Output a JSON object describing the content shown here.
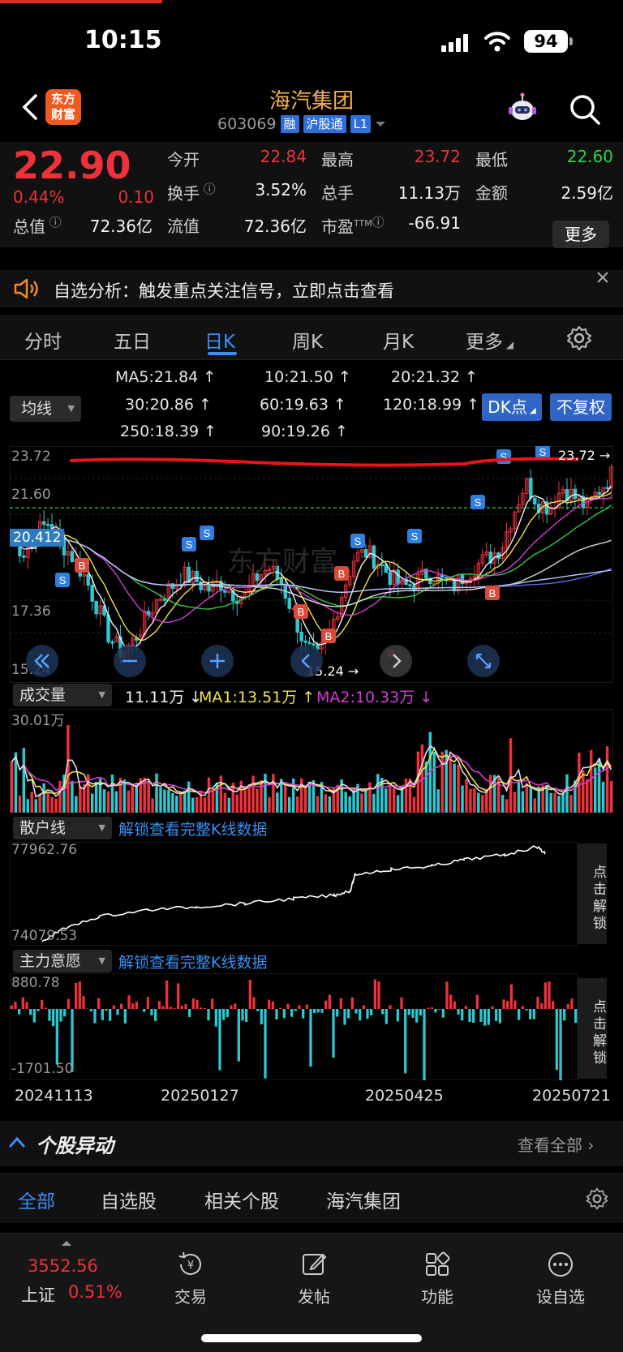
{
  "status_bar": {
    "time": "10:15",
    "battery": "94"
  },
  "header": {
    "stock_name": "海汽集团",
    "code": "603069",
    "tags": [
      "融",
      "沪股通",
      "L1"
    ],
    "logo_text": "东方财富"
  },
  "quote": {
    "price": "22.90",
    "change_pct": "0.44%",
    "change": "0.10",
    "rows": [
      [
        {
          "label": "今开",
          "value": "22.84",
          "color": "red"
        },
        {
          "label": "最高",
          "value": "23.72",
          "color": "red"
        },
        {
          "label": "最低",
          "value": "22.60",
          "color": "green"
        }
      ],
      [
        {
          "label": "换手",
          "value": "3.52%",
          "color": "white"
        },
        {
          "label": "总手",
          "value": "11.13万",
          "color": "white"
        },
        {
          "label": "金额",
          "value": "2.59亿",
          "color": "white"
        }
      ],
      [
        {
          "label": "总值",
          "value": "72.36亿",
          "color": "white"
        },
        {
          "label": "流值",
          "value": "72.36亿",
          "color": "white"
        },
        {
          "label": "市盈",
          "sup": "TTM",
          "value": "-66.91",
          "color": "white"
        }
      ]
    ],
    "more_label": "更多"
  },
  "alert": {
    "text": "自选分析：触发重点关注信号，立即点击查看"
  },
  "tabs": {
    "items": [
      "分时",
      "五日",
      "日K",
      "周K",
      "月K",
      "更多"
    ],
    "active": "日K"
  },
  "ma": {
    "selector": "均线",
    "items": [
      {
        "text": "MA5:21.84 ↑",
        "color": "#f2f2f2"
      },
      {
        "text": "10:21.50 ↑",
        "color": "#f2e34a"
      },
      {
        "text": "20:21.32 ↑",
        "color": "#d63bd6"
      },
      {
        "text": "30:20.86 ↑",
        "color": "#36c84a"
      },
      {
        "text": "60:19.63 ↑",
        "color": "#d8d8d8"
      },
      {
        "text": "120:18.99 ↑",
        "color": "#5a6cf0"
      },
      {
        "text": "250:18.39 ↑",
        "color": "#b8c8f0"
      },
      {
        "text": "90:19.26 ↑",
        "color": "#e22a2a"
      }
    ],
    "dk_button": "DK点",
    "fq_button": "不复权"
  },
  "kchart": {
    "y_labels": [
      "23.72",
      "21.60",
      "20.412",
      "17.36",
      "15.24"
    ],
    "high_marker": "23.72",
    "low_marker": "15.24",
    "watermark": "东方财富"
  },
  "volume": {
    "selector": "成交量",
    "value": "11.11万 ↓",
    "ma1": "MA1:13.51万 ↑",
    "ma2": "MA2:10.33万 ↓",
    "max_label": "30.01万"
  },
  "sanhu": {
    "selector": "散户线",
    "unlock_link": "解锁查看完整K线数据",
    "max_label": "77962.76",
    "min_label": "74079.53",
    "side_btn": "点击解锁"
  },
  "zhuli": {
    "selector": "主力意愿",
    "unlock_link": "解锁查看完整K线数据",
    "max_label": "880.78",
    "min_label": "-1701.50",
    "side_btn": "点击解锁"
  },
  "dates": [
    "20241113",
    "20250127",
    "20250425",
    "20250721"
  ],
  "news": {
    "title": "个股异动",
    "view_all": "查看全部",
    "tabs": [
      "全部",
      "自选股",
      "相关个股",
      "海汽集团"
    ],
    "active_tab": "全部"
  },
  "bottom": {
    "index_value": "3552.56",
    "index_name": "上证",
    "index_pct": "0.51%",
    "items": [
      "交易",
      "发帖",
      "功能",
      "设自选"
    ]
  }
}
